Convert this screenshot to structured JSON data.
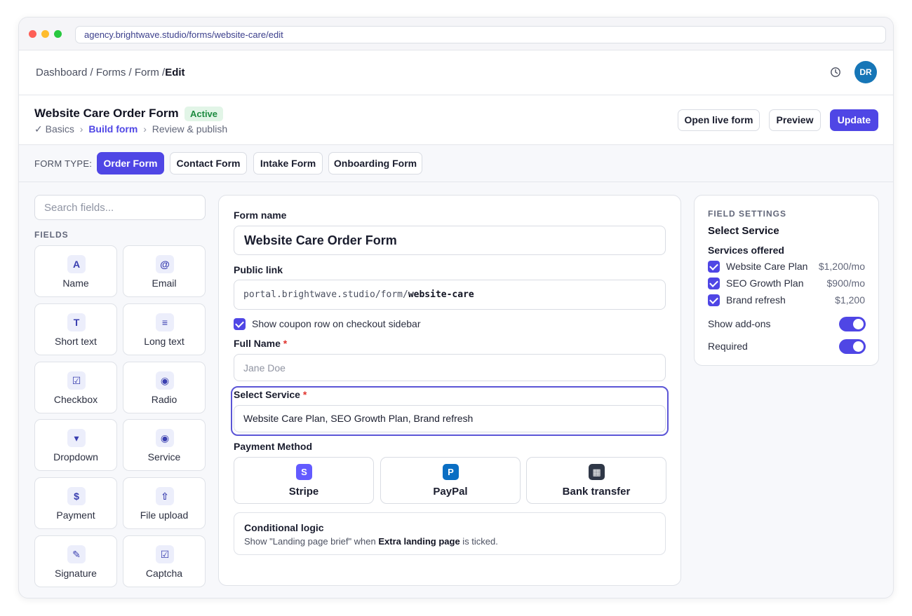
{
  "browser": {
    "url": "agency.brightwave.studio/forms/website-care/edit"
  },
  "topbar": {
    "breadcrumb_path": "Dashboard / Forms / Form /",
    "breadcrumb_current": "Edit",
    "avatar_initials": "DR"
  },
  "header": {
    "title": "Website Care Order Form",
    "status": "Active",
    "steps": {
      "done": "✓ Basics",
      "active": "Build form",
      "next": "Review & publish"
    },
    "buttons": {
      "open_live": "Open live form",
      "preview": "Preview",
      "update": "Update"
    }
  },
  "form_type": {
    "label": "FORM TYPE:",
    "options": [
      "Order Form",
      "Contact Form",
      "Intake Form",
      "Onboarding Form"
    ],
    "selected": "Order Form"
  },
  "fields_panel": {
    "search_placeholder": "Search fields...",
    "heading": "FIELDS",
    "items": [
      {
        "label": "Name",
        "glyph": "A",
        "icon": "name-icon"
      },
      {
        "label": "Email",
        "glyph": "@",
        "icon": "email-icon"
      },
      {
        "label": "Short text",
        "glyph": "T",
        "icon": "short-text-icon"
      },
      {
        "label": "Long text",
        "glyph": "≡",
        "icon": "long-text-icon"
      },
      {
        "label": "Checkbox",
        "glyph": "☑",
        "icon": "checkbox-icon"
      },
      {
        "label": "Radio",
        "glyph": "◉",
        "icon": "radio-icon"
      },
      {
        "label": "Dropdown",
        "glyph": "▾",
        "icon": "dropdown-icon"
      },
      {
        "label": "Service",
        "glyph": "◉",
        "icon": "service-icon"
      },
      {
        "label": "Payment",
        "glyph": "$",
        "icon": "payment-icon"
      },
      {
        "label": "File upload",
        "glyph": "⇧",
        "icon": "file-upload-icon"
      },
      {
        "label": "Signature",
        "glyph": "✎",
        "icon": "signature-icon"
      },
      {
        "label": "Captcha",
        "glyph": "☑",
        "icon": "captcha-icon"
      }
    ]
  },
  "builder": {
    "form_name_label": "Form name",
    "form_name_value": "Website Care Order Form",
    "public_link_label": "Public link",
    "public_link_prefix": "portal.brightwave.studio/form/",
    "public_link_slug": "website-care",
    "coupon_checkbox_label": "Show coupon row on checkout sidebar",
    "coupon_checked": true,
    "full_name_label": "Full Name",
    "full_name_placeholder": "Jane Doe",
    "required_marker": "*",
    "select_service_label": "Select Service",
    "select_service_value": "Website Care Plan, SEO Growth Plan, Brand refresh",
    "payment_method_label": "Payment Method",
    "payment_options": [
      {
        "label": "Stripe",
        "glyph": "S",
        "color": "#635bff"
      },
      {
        "label": "PayPal",
        "glyph": "P",
        "color": "#0a6ec3"
      },
      {
        "label": "Bank transfer",
        "glyph": "▦",
        "color": "#2f3747"
      }
    ],
    "conditional": {
      "title": "Conditional logic",
      "desc_before": "Show \"Landing page brief\" when ",
      "desc_bold": "Extra landing page",
      "desc_after": " is ticked."
    }
  },
  "settings": {
    "heading": "FIELD SETTINGS",
    "field_title": "Select Service",
    "services_label": "Services offered",
    "services": [
      {
        "name": "Website Care Plan",
        "price": "$1,200/mo",
        "checked": true
      },
      {
        "name": "SEO Growth Plan",
        "price": "$900/mo",
        "checked": true
      },
      {
        "name": "Brand refresh",
        "price": "$1,200",
        "checked": true
      }
    ],
    "toggles": [
      {
        "label": "Show add-ons",
        "on": true
      },
      {
        "label": "Required",
        "on": true
      }
    ]
  },
  "colors": {
    "accent": "#4f46e5",
    "active_badge_bg": "#e2f5e7",
    "active_badge_text": "#1c8a3f",
    "avatar": "#1676b7",
    "required": "#e0342e"
  }
}
